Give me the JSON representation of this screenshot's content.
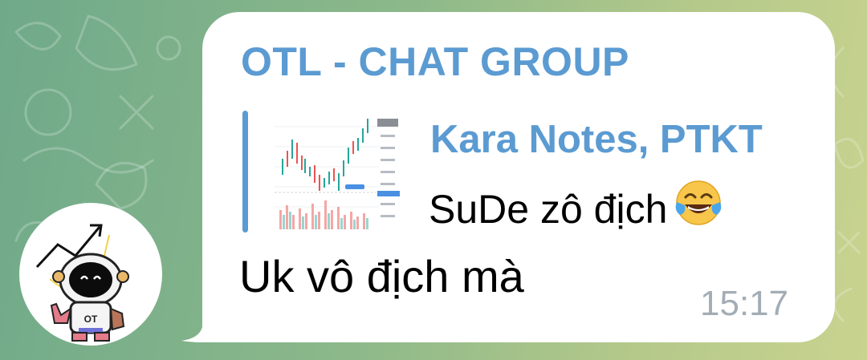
{
  "chat": {
    "sender_name": "OTL - CHAT GROUP",
    "reply": {
      "author": "Kara Notes, PTKT",
      "text": "SuDe zô địch",
      "emoji": "face-with-tears-of-joy"
    },
    "message_text": "Uk vô địch mà",
    "time": "15:17"
  },
  "avatar": {
    "logo_text": "OT"
  },
  "colors": {
    "accent": "#5b9bd2",
    "bubble": "#ffffff",
    "time_text": "#a3adb6",
    "wallpaper_left": "#6fa98a",
    "wallpaper_right": "#c9d38f"
  }
}
